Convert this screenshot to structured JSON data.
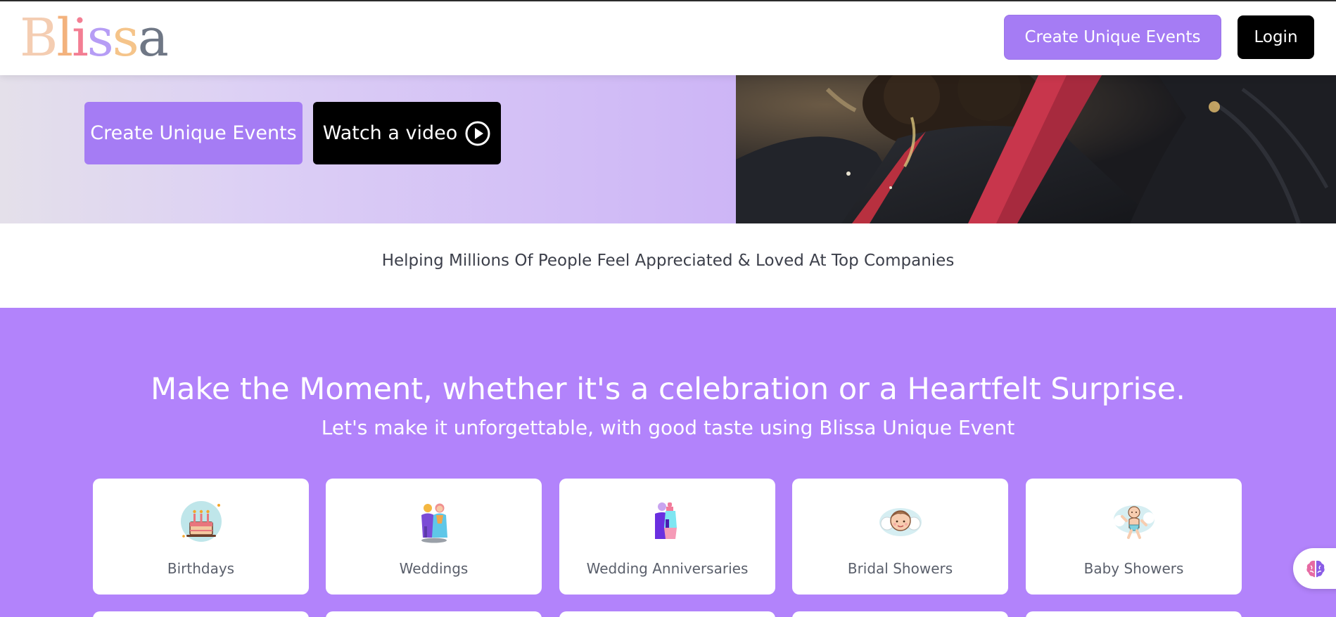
{
  "header": {
    "logo_text": "Blissa",
    "create_button": "Create Unique Events",
    "login_button": "Login"
  },
  "hero": {
    "create_button": "Create Unique Events",
    "video_button": "Watch a video"
  },
  "trust": {
    "text": "Helping Millions Of People Feel Appreciated & Loved At Top Companies"
  },
  "events_section": {
    "headline": "Make the Moment, whether it's a celebration or a Heartfelt Surprise.",
    "subheadline": "Let's make it unforgettable, with good taste using Blissa Unique Event",
    "cards": [
      {
        "label": "Birthdays",
        "icon": "birthday-cake-icon"
      },
      {
        "label": "Weddings",
        "icon": "wedding-couple-icon"
      },
      {
        "label": "Wedding Anniversaries",
        "icon": "anniversary-couple-icon"
      },
      {
        "label": "Bridal Showers",
        "icon": "bride-icon"
      },
      {
        "label": "Baby Showers",
        "icon": "baby-icon"
      }
    ]
  },
  "colors": {
    "brand_purple": "#b283fb",
    "button_purple": "#a57cf4",
    "black": "#000000"
  }
}
